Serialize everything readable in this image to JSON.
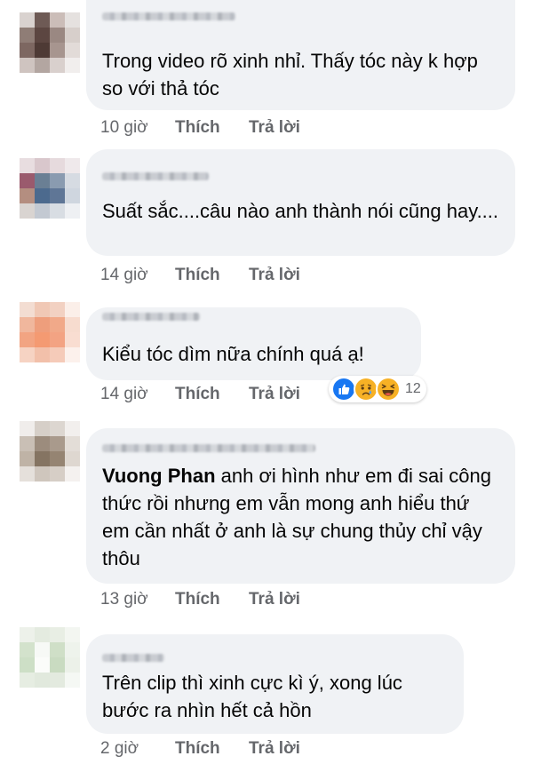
{
  "comments": [
    {
      "text": "Trong video rõ xinh nhỉ. Thấy tóc này k hợp so với thả tóc",
      "time": "10 giờ",
      "like": "Thích",
      "reply": "Trả lời"
    },
    {
      "text": "Suất sắc....câu nào anh thành nói cũng hay....",
      "time": "14 giờ",
      "like": "Thích",
      "reply": "Trả lời"
    },
    {
      "text": "Kiểu tóc dìm nữa chính quá ạ!",
      "time": "14 giờ",
      "like": "Thích",
      "reply": "Trả lời",
      "reactions": {
        "icons": [
          "like-reaction-icon",
          "sad-reaction-icon",
          "haha-reaction-icon"
        ],
        "count": "12"
      }
    },
    {
      "mention": "Vuong Phan",
      "text": "anh ơi hình như em đi sai công thức rồi nhưng em vẫn mong anh hiểu thứ em cần nhất ở anh là sự chung thủy chỉ vậy thôu",
      "time": "13 giờ",
      "like": "Thích",
      "reply": "Trả lời"
    },
    {
      "text": "Trên clip thì xinh cực kì ý, xong lúc bước ra nhìn hết cả hồn",
      "time": "2 giờ",
      "like": "Thích",
      "reply": "Trả lời"
    }
  ],
  "colors": {
    "bubble": "#f0f2f5",
    "meta_text": "#65676b",
    "like_blue": "#1877f2",
    "reaction_yellow": "#f7b125"
  }
}
